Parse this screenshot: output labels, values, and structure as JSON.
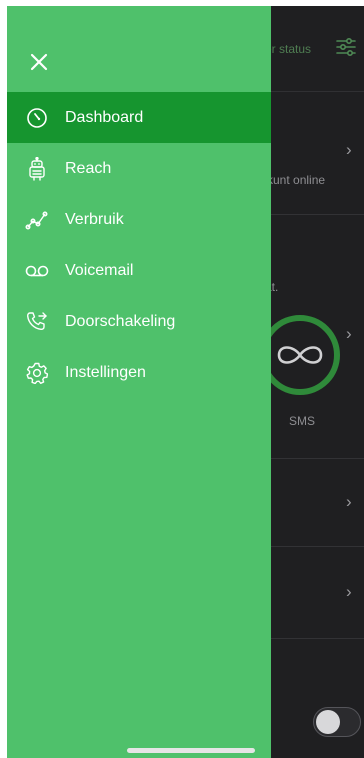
{
  "background": {
    "status_label": "er status",
    "online_text": "l kunt online",
    "dat_text": "at.",
    "sms_label": "SMS",
    "chevron": "›"
  },
  "drawer": {
    "close_icon": "close-icon",
    "items": [
      {
        "label": "Dashboard",
        "icon": "dashboard-icon",
        "active": true
      },
      {
        "label": "Reach",
        "icon": "robot-icon",
        "active": false
      },
      {
        "label": "Verbruik",
        "icon": "usage-graph-icon",
        "active": false
      },
      {
        "label": "Voicemail",
        "icon": "voicemail-icon",
        "active": false
      },
      {
        "label": "Doorschakeling",
        "icon": "call-forward-icon",
        "active": false
      },
      {
        "label": "Instellingen",
        "icon": "settings-gear-icon",
        "active": false
      }
    ]
  },
  "colors": {
    "drawer_bg": "#4fc16b",
    "active_item_bg": "#16952f",
    "app_bg": "#1f1f21",
    "accent_green": "#2f8a3a"
  }
}
